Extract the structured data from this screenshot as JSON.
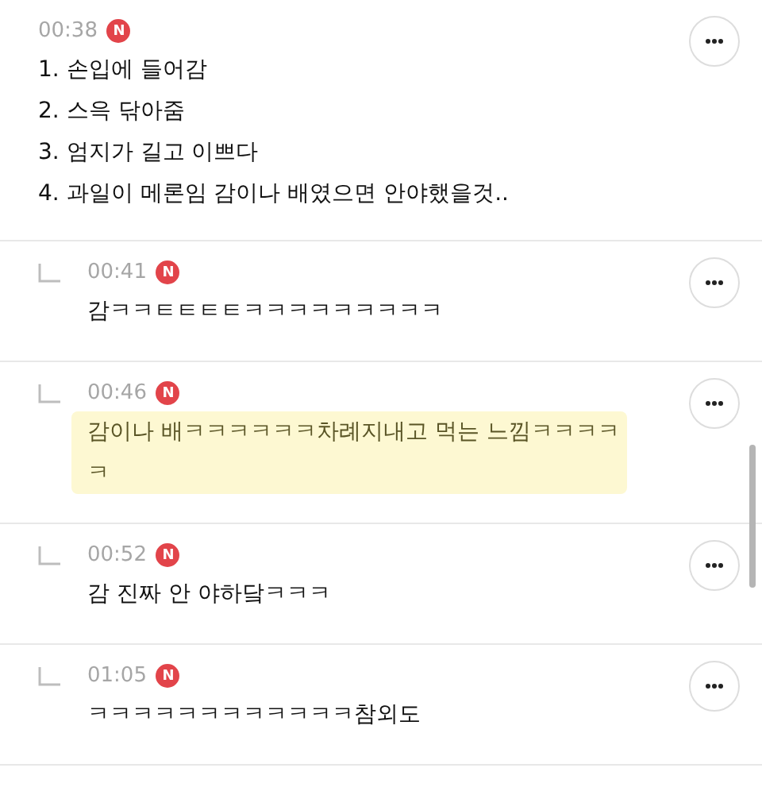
{
  "comments": [
    {
      "reply": false,
      "time": "00:38",
      "badge": "N",
      "highlighted": false,
      "lines": [
        "1. 손입에 들어감",
        "2. 스윽 닦아줌",
        "3. 엄지가 길고 이쁘다",
        "4. 과일이 메론임 감이나 배였으면 안야했을것.."
      ]
    },
    {
      "reply": true,
      "time": "00:41",
      "badge": "N",
      "highlighted": false,
      "lines": [
        "감ㅋㅋㅌㅌㅌㅌㅋㅋㅋㅋㅋㅋㅋㅋㅋ"
      ]
    },
    {
      "reply": true,
      "time": "00:46",
      "badge": "N",
      "highlighted": true,
      "lines": [
        "감이나 배ㅋㅋㅋㅋㅋㅋ차례지내고 먹는 느낌ㅋㅋㅋㅋㅋ"
      ]
    },
    {
      "reply": true,
      "time": "00:52",
      "badge": "N",
      "highlighted": false,
      "lines": [
        "감 진짜 안 야하닼ㅋㅋㅋ"
      ]
    },
    {
      "reply": true,
      "time": "01:05",
      "badge": "N",
      "highlighted": false,
      "lines": [
        "ㅋㅋㅋㅋㅋㅋㅋㅋㅋㅋㅋㅋ참외도"
      ]
    }
  ]
}
